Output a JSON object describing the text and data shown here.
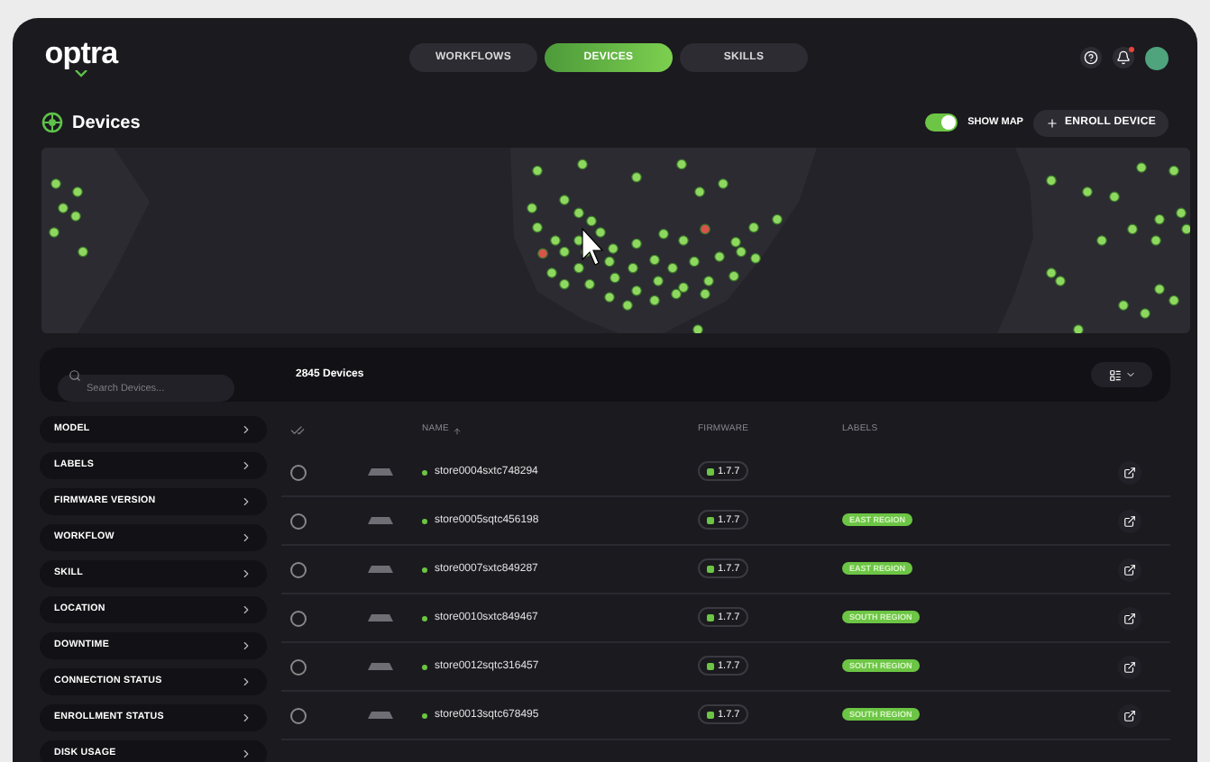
{
  "brand": "optra",
  "nav": [
    {
      "label": "WORKFLOWS",
      "selected": false
    },
    {
      "label": "DEVICES",
      "selected": true
    },
    {
      "label": "SKILLS",
      "selected": false
    }
  ],
  "notifications": {
    "unread": true
  },
  "page_title": "Devices",
  "show_map": {
    "label": "SHOW MAP",
    "on": true
  },
  "enroll_button": "ENROLL DEVICE",
  "search": {
    "placeholder": "Search Devices..."
  },
  "device_count": "2845 Devices",
  "filters": [
    "MODEL",
    "LABELS",
    "FIRMWARE VERSION",
    "WORKFLOW",
    "SKILL",
    "LOCATION",
    "DOWNTIME",
    "CONNECTION STATUS",
    "ENROLLMENT STATUS",
    "DISK USAGE"
  ],
  "columns": [
    {
      "label": "NAME",
      "sorted": true
    },
    {
      "label": "FIRMWARE",
      "sorted": false
    },
    {
      "label": "LABELS",
      "sorted": false
    }
  ],
  "rows": [
    {
      "name": "store0004sxtc748294",
      "firmware": "1.7.7",
      "selected": false
    },
    {
      "name": "store0005sqtc456198",
      "firmware": "1.7.7",
      "label": "EAST REGION",
      "selected": false
    },
    {
      "name": "store0007sxtc849287",
      "firmware": "1.7.7",
      "label": "EAST REGION",
      "selected": false
    },
    {
      "name": "store0010sxtc849467",
      "firmware": "1.7.7",
      "label": "SOUTH REGION",
      "selected": false
    },
    {
      "name": "store0012sqtc316457",
      "firmware": "1.7.7",
      "label": "SOUTH REGION",
      "selected": false
    },
    {
      "name": "store0013sqtc678495",
      "firmware": "1.7.7",
      "label": "SOUTH REGION",
      "selected": false
    }
  ]
}
